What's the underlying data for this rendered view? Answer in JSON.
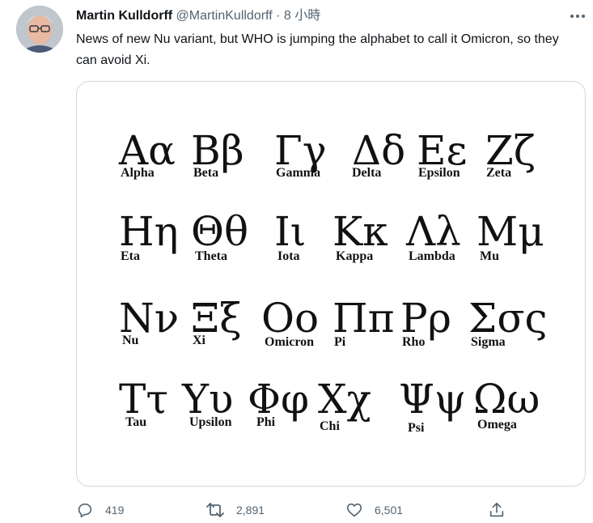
{
  "tweet": {
    "author_name": "Martin Kulldorff",
    "handle": "@MartinKulldorff",
    "dot": "·",
    "time": "8 小時",
    "text": "News of new Nu variant, but WHO is jumping the alphabet to call it Omicron, so they can avoid Xi."
  },
  "greek_letters": [
    {
      "glyphs": "Αα",
      "name": "Alpha"
    },
    {
      "glyphs": "Ββ",
      "name": "Beta"
    },
    {
      "glyphs": "Γγ",
      "name": "Gamma"
    },
    {
      "glyphs": "Δδ",
      "name": "Delta"
    },
    {
      "glyphs": "Εε",
      "name": "Epsilon"
    },
    {
      "glyphs": "Ζζ",
      "name": "Zeta"
    },
    {
      "glyphs": "Ηη",
      "name": "Eta"
    },
    {
      "glyphs": "Θθ",
      "name": "Theta"
    },
    {
      "glyphs": "Ιι",
      "name": "Iota"
    },
    {
      "glyphs": "Κκ",
      "name": "Kappa"
    },
    {
      "glyphs": "Λλ",
      "name": "Lambda"
    },
    {
      "glyphs": "Μμ",
      "name": "Mu"
    },
    {
      "glyphs": "Νν",
      "name": "Nu"
    },
    {
      "glyphs": "Ξξ",
      "name": "Xi"
    },
    {
      "glyphs": "Οο",
      "name": "Omicron"
    },
    {
      "glyphs": "Ππ",
      "name": "Pi"
    },
    {
      "glyphs": "Ρρ",
      "name": "Rho"
    },
    {
      "glyphs": "Σσς",
      "name": "Sigma"
    },
    {
      "glyphs": "Ττ",
      "name": "Tau"
    },
    {
      "glyphs": "Υυ",
      "name": "Upsilon"
    },
    {
      "glyphs": "Φφ",
      "name": "Phi"
    },
    {
      "glyphs": "Χχ",
      "name": "Chi"
    },
    {
      "glyphs": "Ψψ",
      "name": "Psi"
    },
    {
      "glyphs": "Ωω",
      "name": "Omega"
    }
  ],
  "actions": {
    "reply": {
      "icon": "reply-icon",
      "count": "419"
    },
    "retweet": {
      "icon": "retweet-icon",
      "count": "2,891"
    },
    "like": {
      "icon": "heart-icon",
      "count": "6,501"
    },
    "share": {
      "icon": "share-icon"
    }
  },
  "colors": {
    "text": "#0f1419",
    "secondary": "#536471",
    "border": "#cfd9de"
  }
}
